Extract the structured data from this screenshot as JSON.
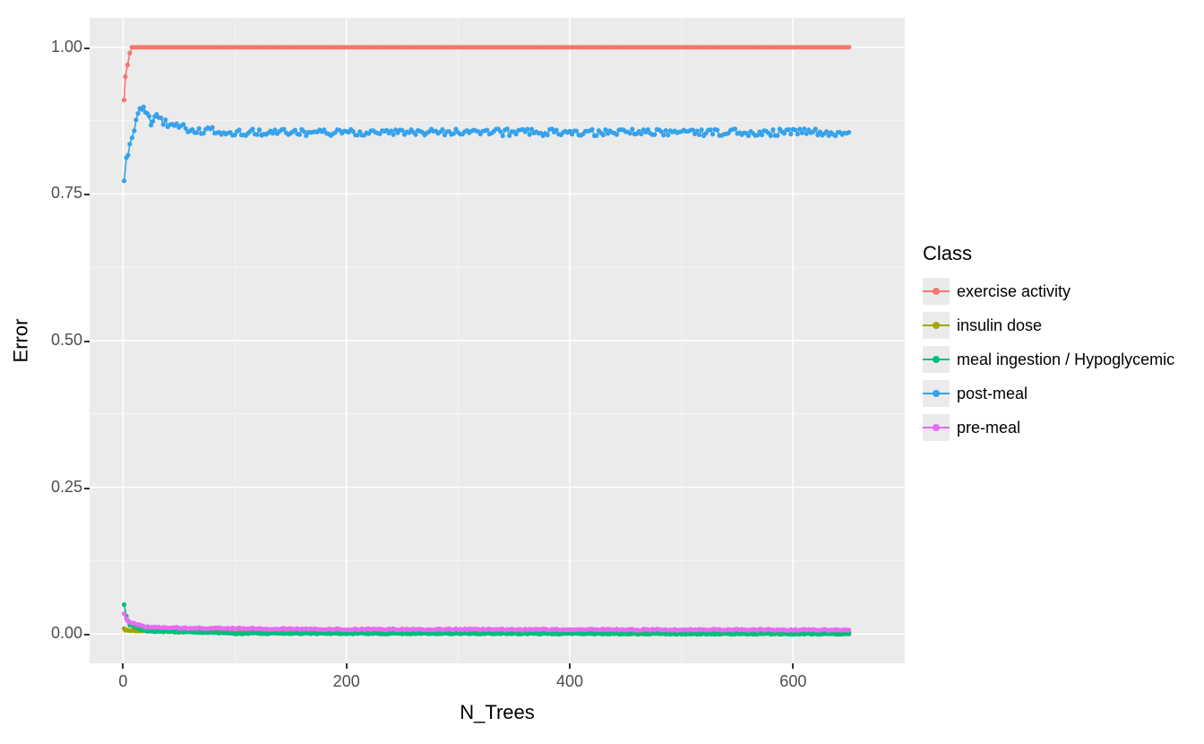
{
  "chart_data": {
    "type": "line",
    "title": "",
    "xlabel": "N_Trees",
    "ylabel": "Error",
    "xlim": [
      -30,
      700
    ],
    "ylim": [
      -0.05,
      1.05
    ],
    "x_ticks": [
      0,
      200,
      400,
      600
    ],
    "y_ticks": [
      0.0,
      0.25,
      0.5,
      0.75,
      1.0
    ],
    "y_tick_labels": [
      "0.00",
      "0.25",
      "0.50",
      "0.75",
      "1.00"
    ],
    "grid": true,
    "legend_title": "Class",
    "legend_position": "right",
    "series": [
      {
        "name": "exercise activity",
        "color": "#F8766D",
        "approx": [
          {
            "x": 1,
            "y": 0.91
          },
          {
            "x": 2,
            "y": 0.95
          },
          {
            "x": 4,
            "y": 0.97
          },
          {
            "x": 6,
            "y": 0.99
          },
          {
            "x": 8,
            "y": 1.0
          },
          {
            "x": 50,
            "y": 1.0
          },
          {
            "x": 650,
            "y": 1.0
          }
        ]
      },
      {
        "name": "insulin dose",
        "color": "#A3A500",
        "approx": [
          {
            "x": 1,
            "y": 0.009
          },
          {
            "x": 2,
            "y": 0.007
          },
          {
            "x": 5,
            "y": 0.006
          },
          {
            "x": 50,
            "y": 0.004
          },
          {
            "x": 650,
            "y": 0.003
          }
        ]
      },
      {
        "name": "meal ingestion / Hypoglycemic",
        "color": "#00BF7D",
        "approx": [
          {
            "x": 1,
            "y": 0.05
          },
          {
            "x": 3,
            "y": 0.03
          },
          {
            "x": 6,
            "y": 0.015
          },
          {
            "x": 20,
            "y": 0.005
          },
          {
            "x": 100,
            "y": 0.001
          },
          {
            "x": 650,
            "y": 0.0
          }
        ]
      },
      {
        "name": "post-meal",
        "color": "#35A2EB",
        "approx": [
          {
            "x": 1,
            "y": 0.77
          },
          {
            "x": 3,
            "y": 0.81
          },
          {
            "x": 6,
            "y": 0.83
          },
          {
            "x": 10,
            "y": 0.86
          },
          {
            "x": 15,
            "y": 0.9
          },
          {
            "x": 20,
            "y": 0.89
          },
          {
            "x": 25,
            "y": 0.87
          },
          {
            "x": 30,
            "y": 0.88
          },
          {
            "x": 40,
            "y": 0.87
          },
          {
            "x": 60,
            "y": 0.86
          },
          {
            "x": 100,
            "y": 0.855
          },
          {
            "x": 200,
            "y": 0.855
          },
          {
            "x": 400,
            "y": 0.855
          },
          {
            "x": 650,
            "y": 0.855
          }
        ]
      },
      {
        "name": "pre-meal",
        "color": "#E76BF3",
        "approx": [
          {
            "x": 1,
            "y": 0.035
          },
          {
            "x": 3,
            "y": 0.025
          },
          {
            "x": 6,
            "y": 0.02
          },
          {
            "x": 20,
            "y": 0.012
          },
          {
            "x": 60,
            "y": 0.01
          },
          {
            "x": 200,
            "y": 0.008
          },
          {
            "x": 650,
            "y": 0.007
          }
        ]
      }
    ]
  }
}
